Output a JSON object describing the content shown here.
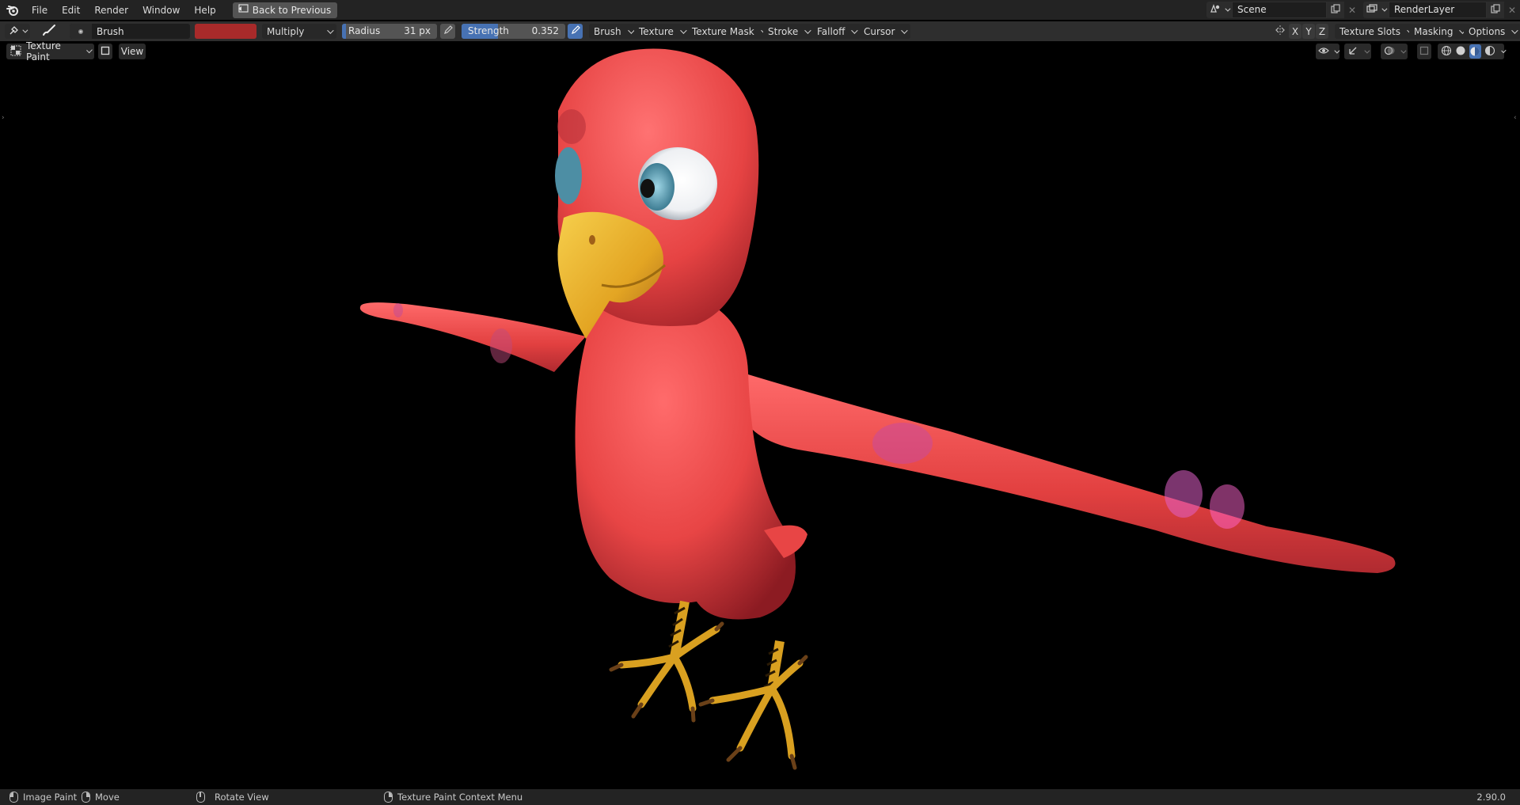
{
  "topbar": {
    "menus": [
      "File",
      "Edit",
      "Render",
      "Window",
      "Help"
    ],
    "back_button": "Back to Previous",
    "scene": "Scene",
    "render_layer": "RenderLayer"
  },
  "toolbar": {
    "brush_name": "Brush",
    "brush_color": "#a82a2a",
    "blend_mode": "Multiply",
    "radius_label": "Radius",
    "radius_value": "31 px",
    "strength_label": "Strength",
    "strength_value": "0.352",
    "strength_fraction": 0.352,
    "dropdowns": [
      "Brush",
      "Texture",
      "Texture Mask",
      "Stroke",
      "Falloff",
      "Cursor"
    ],
    "axes": [
      "X",
      "Y",
      "Z"
    ],
    "right_dropdowns": [
      "Texture Slots",
      "Masking",
      "Options"
    ]
  },
  "viewport_header": {
    "mode": "Texture Paint",
    "view_menu": "View"
  },
  "statusbar": {
    "left_click": "Image Paint",
    "right_drag": "Move",
    "middle": "Rotate View",
    "context": "Texture Paint Context Menu",
    "version": "2.90.0"
  },
  "colors": {
    "accent": "#4772b3",
    "parrot_body": "#e84545"
  }
}
